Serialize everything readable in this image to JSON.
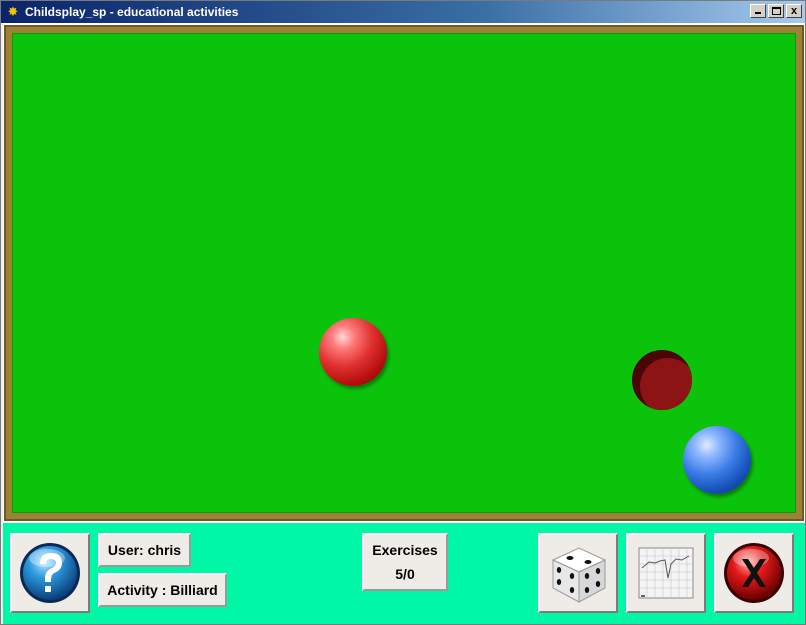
{
  "window": {
    "title": "Childsplay_sp - educational activities",
    "close_glyph": "x"
  },
  "status": {
    "user": "User: chris",
    "activity": "Activity : Billiard",
    "exercises_label": "Exercises",
    "exercises_value": "5/0"
  },
  "toolbar": {
    "help_icon": "question-mark-icon",
    "dice_icon": "dice-icon",
    "graph_icon": "graph-icon",
    "quit_icon": "quit-icon"
  },
  "colors": {
    "felt": "#0cc30c",
    "rail": "#9b8237",
    "bottom_bar": "#00f7a5",
    "red_ball": "#e03030",
    "blue_ball": "#3a7ce6",
    "hole": "#8a1212"
  }
}
